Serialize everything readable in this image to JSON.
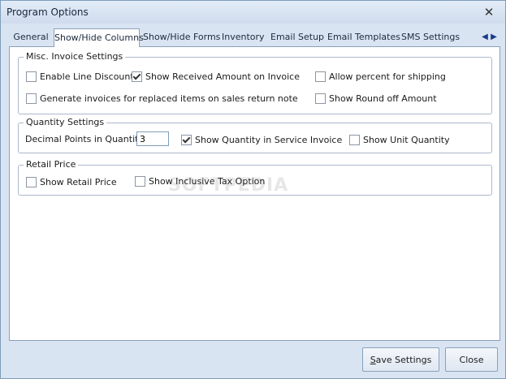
{
  "window": {
    "title": "Program Options",
    "close_glyph": "✕"
  },
  "tabs": [
    {
      "label": "General",
      "active": false
    },
    {
      "label": "Show/Hide Columns",
      "active": true
    },
    {
      "label": "Show/Hide Forms",
      "active": false
    },
    {
      "label": "Inventory",
      "active": false
    },
    {
      "label": "Email Setup",
      "active": false
    },
    {
      "label": "Email Templates",
      "active": false
    },
    {
      "label": "SMS Settings",
      "active": false
    }
  ],
  "tab_arrows": {
    "left": "◀",
    "right": "▶"
  },
  "misc": {
    "title": "Misc. Invoice Settings",
    "enable_line_discount": "Enable Line Discount",
    "show_received_amount": "Show Received Amount on Invoice",
    "allow_percent_shipping": "Allow percent for shipping",
    "generate_invoices_return": "Generate invoices for replaced items on sales return note",
    "show_round_off": "Show Round off Amount"
  },
  "quantity": {
    "title": "Quantity Settings",
    "decimal_points_label": "Decimal Points in Quantity",
    "decimal_points_value": "3",
    "show_qty_service_invoice": "Show Quantity in Service Invoice",
    "show_unit_quantity": "Show Unit Quantity"
  },
  "retail": {
    "title": "Retail Price",
    "show_retail_price": "Show Retail Price",
    "show_inclusive_tax": "Show Inclusive Tax Option"
  },
  "checked": {
    "enable_line_discount": false,
    "show_received_amount": true,
    "allow_percent_shipping": false,
    "generate_invoices_return": false,
    "show_round_off": false,
    "show_qty_service_invoice": true,
    "show_unit_quantity": false,
    "show_retail_price": false,
    "show_inclusive_tax": false
  },
  "buttons": {
    "save_first": "S",
    "save_rest": "ave Settings",
    "close": "Close"
  },
  "watermark": "SOFTPEDIA"
}
